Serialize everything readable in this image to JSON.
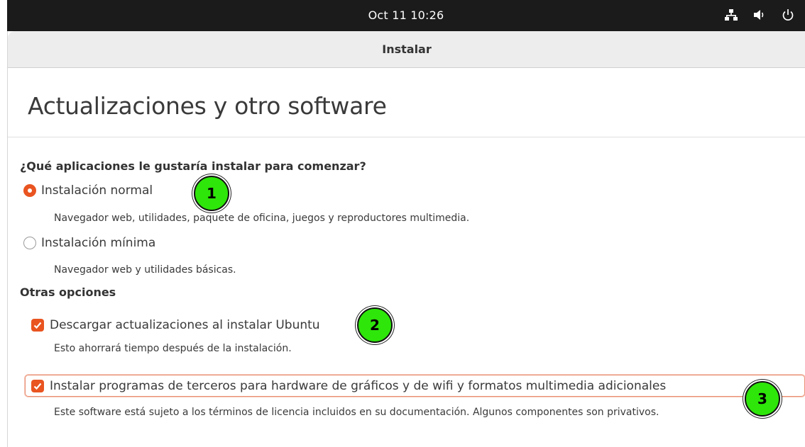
{
  "topbar": {
    "clock": "Oct 11  10:26",
    "tray_icons": [
      "network-icon",
      "volume-icon",
      "power-icon"
    ]
  },
  "window": {
    "title": "Instalar"
  },
  "page": {
    "heading": "Actualizaciones y otro software"
  },
  "section1": {
    "question": "¿Qué aplicaciones le gustaría instalar para comenzar?",
    "options": [
      {
        "label": "Instalación normal",
        "description": "Navegador web, utilidades, paquete de oficina, juegos y reproductores multimedia.",
        "selected": true
      },
      {
        "label": "Instalación mínima",
        "description": "Navegador web y utilidades básicas.",
        "selected": false
      }
    ]
  },
  "section2": {
    "title": "Otras opciones",
    "options": [
      {
        "label": "Descargar actualizaciones al instalar Ubuntu",
        "description": "Esto ahorrará tiempo después de la instalación.",
        "checked": true
      },
      {
        "label": "Instalar programas de terceros para hardware de gráficos y de wifi y formatos multimedia adicionales",
        "description": "Este software está sujeto a los términos de licencia incluidos en su documentación. Algunos componentes son privativos.",
        "checked": true
      }
    ]
  },
  "markers": [
    "1",
    "2",
    "3"
  ],
  "colors": {
    "accent": "#e95420",
    "marker": "#2ee60a",
    "topbar": "#1b1b1b"
  }
}
